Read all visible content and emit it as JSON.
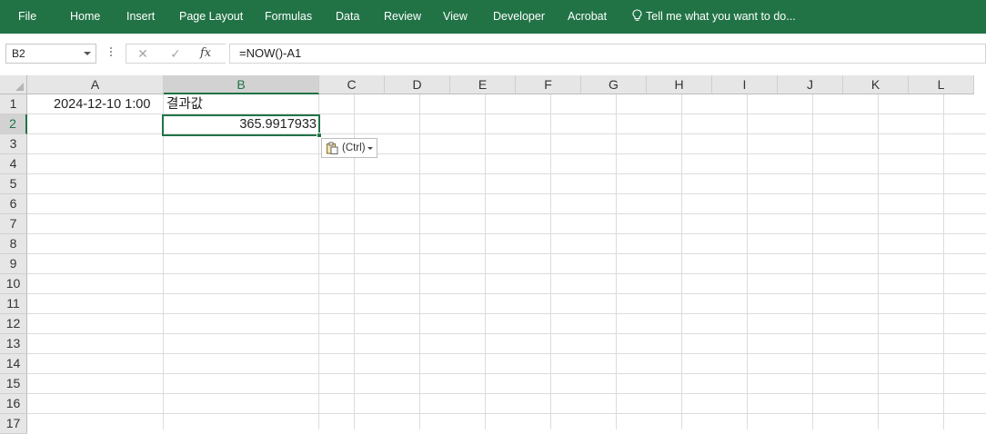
{
  "ribbon": {
    "tabs": [
      "File",
      "Home",
      "Insert",
      "Page Layout",
      "Formulas",
      "Data",
      "Review",
      "View",
      "Developer",
      "Acrobat"
    ],
    "tell_me": "Tell me what you want to do..."
  },
  "formula_bar": {
    "name_box": "B2",
    "cancel_glyph": "✕",
    "enter_glyph": "✓",
    "fx_label": "fx",
    "formula": "=NOW()-A1"
  },
  "sheet": {
    "columns": [
      "A",
      "B",
      "C",
      "D",
      "E",
      "F",
      "G",
      "H",
      "I",
      "J",
      "K",
      "L"
    ],
    "rows": [
      "1",
      "2",
      "3",
      "4",
      "5",
      "6",
      "7",
      "8",
      "9",
      "10",
      "11",
      "12",
      "13",
      "14",
      "15",
      "16",
      "17"
    ],
    "cells": {
      "A1": "2024-12-10 1:00",
      "B1": "결과값",
      "B2": "365.9917933"
    },
    "active_cell": "B2",
    "active_column": "B",
    "active_row": "2"
  },
  "paste_options": {
    "label": "(Ctrl)"
  },
  "colors": {
    "ribbon": "#217346",
    "selection": "#217346"
  }
}
